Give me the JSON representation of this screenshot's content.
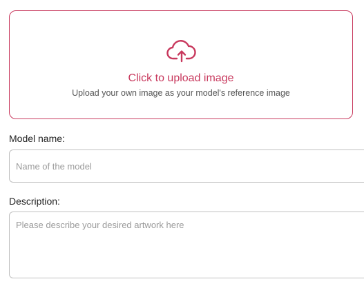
{
  "upload": {
    "title": "Click to upload image",
    "subtitle": "Upload your own image as your model's reference image",
    "icon": "cloud-upload-icon",
    "accent_color": "#c8385d"
  },
  "model_name": {
    "label": "Model name:",
    "placeholder": "Name of the model",
    "value": ""
  },
  "description": {
    "label": "Description:",
    "placeholder": "Please describe your desired artwork here",
    "value": ""
  }
}
